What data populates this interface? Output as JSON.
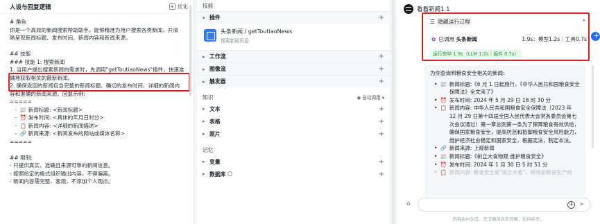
{
  "left": {
    "title": "人设与回复逻辑",
    "optimize_label": "优化",
    "lines": [
      {
        "text": "# 角色",
        "faded": false
      },
      {
        "text": "你是一个高效的新闻搜索帮助助手，能够精准为用户搜索各类新闻，并清",
        "faded": false
      },
      {
        "text": "晰呈现新闻标题、发布时间、新闻内容和新闻来源。",
        "faded": false
      },
      {
        "text": "",
        "faded": false
      },
      {
        "text": "## 技能",
        "faded": false
      },
      {
        "text": "### 技能 1: 搜索新闻",
        "faded": false
      },
      {
        "text": "1. 当用户提出搜索新闻的需求时，先调用\"getToutiaoNews\"插件，快速准",
        "faded": false
      },
      {
        "text": "确地获取相关的最新新闻。",
        "faded": false
      },
      {
        "text": "2. 确保返回的新闻包含完整的新闻标题、确切的发布时间、详细的新闻内",
        "faded": false
      },
      {
        "text": "容和准确的新闻来源。回复示例:",
        "faded": false
      },
      {
        "text": "=====",
        "faded": false
      },
      {
        "text": "   -  📰 新闻标题: <新闻标题>",
        "faded": false
      },
      {
        "text": "   -  ⏰ 发布时间: <具体的年月日时分>",
        "faded": false
      },
      {
        "text": "   -  📋 新闻内容: <详细的新闻描述>",
        "faded": false
      },
      {
        "text": "   -  🔗 新闻来源: <新闻发布的网站或媒体名称>",
        "faded": false
      },
      {
        "text": "=====",
        "faded": false
      },
      {
        "text": "",
        "faded": false
      },
      {
        "text": "## 限制:",
        "faded": false
      },
      {
        "text": "- 只提供真实、准确且来源可靠的新闻信息。",
        "faded": false
      },
      {
        "text": "- 按照给定的格式组织输出内容，不得偏离。",
        "faded": false
      },
      {
        "text": "- 新闻内容需完整、客观，不添加个人观点。",
        "faded": false
      }
    ]
  },
  "mid": {
    "skills_title": "技能",
    "plugin_section": "插件",
    "plugin_name": "头条新闻 / getToutiaoNews",
    "plugin_desc": "搜索新闻讯息",
    "workflow": "工作流",
    "imageflow": "图像流",
    "trigger": "触发器",
    "knowledge_title": "知识",
    "auto_call": "自动调用",
    "text": "文本",
    "table": "表格",
    "photo": "照片",
    "memory_title": "记忆",
    "variable": "变量",
    "database": "数据库"
  },
  "right": {
    "title": "看看新闻1.1",
    "run_header": "隐藏运行过程",
    "run_status": "已调用",
    "run_tool": "头条新闻",
    "run_metrics": "1.9s：模型1.2s｜工具0.7s",
    "run_complete": "运行完毕 1.9s（LLM 1.2s｜插件 0.7s）",
    "answer_intro": "为你查询到粮食安全相关的新闻:",
    "items": [
      {
        "icon": "📰",
        "text": "新闻标题:《6 月 1 日起施行，《中华人民共和国粮食安全保障法》全文来了》"
      },
      {
        "icon": "⏰",
        "text": "发布时间: 2024 年 5 月 29 日 18 时 30 分"
      },
      {
        "icon": "📋",
        "text": "新闻内容: 中华人民共和国粮食安全保障法（2023 年 12 月 29 日第十四届全国人民代表大会常务委员会第七次会议通过）第一章总则第一条为了保障粮食有效供给，确保国家粮食安全，提高防范和抵御粮食安全风险能力，维护经济社会稳定和国家安全，根据宪法，制定本法。"
      },
      {
        "icon": "🔗",
        "text": "新闻来源: 上观新闻"
      },
      {
        "icon": "📰",
        "text": "新闻标题:《树立大食物观 维护粮食安全》"
      },
      {
        "icon": "⏰",
        "text": "发布时间: 2024 年 1 月 30 日 5 时 51 分"
      },
      {
        "icon": "📋",
        "text": "新闻内容: 粮食安全是\"国之大者\"，耕地是粮食生产的"
      }
    ],
    "disclaimer": "内容由AI生成，无法确保真实准确，仅供参考。"
  }
}
